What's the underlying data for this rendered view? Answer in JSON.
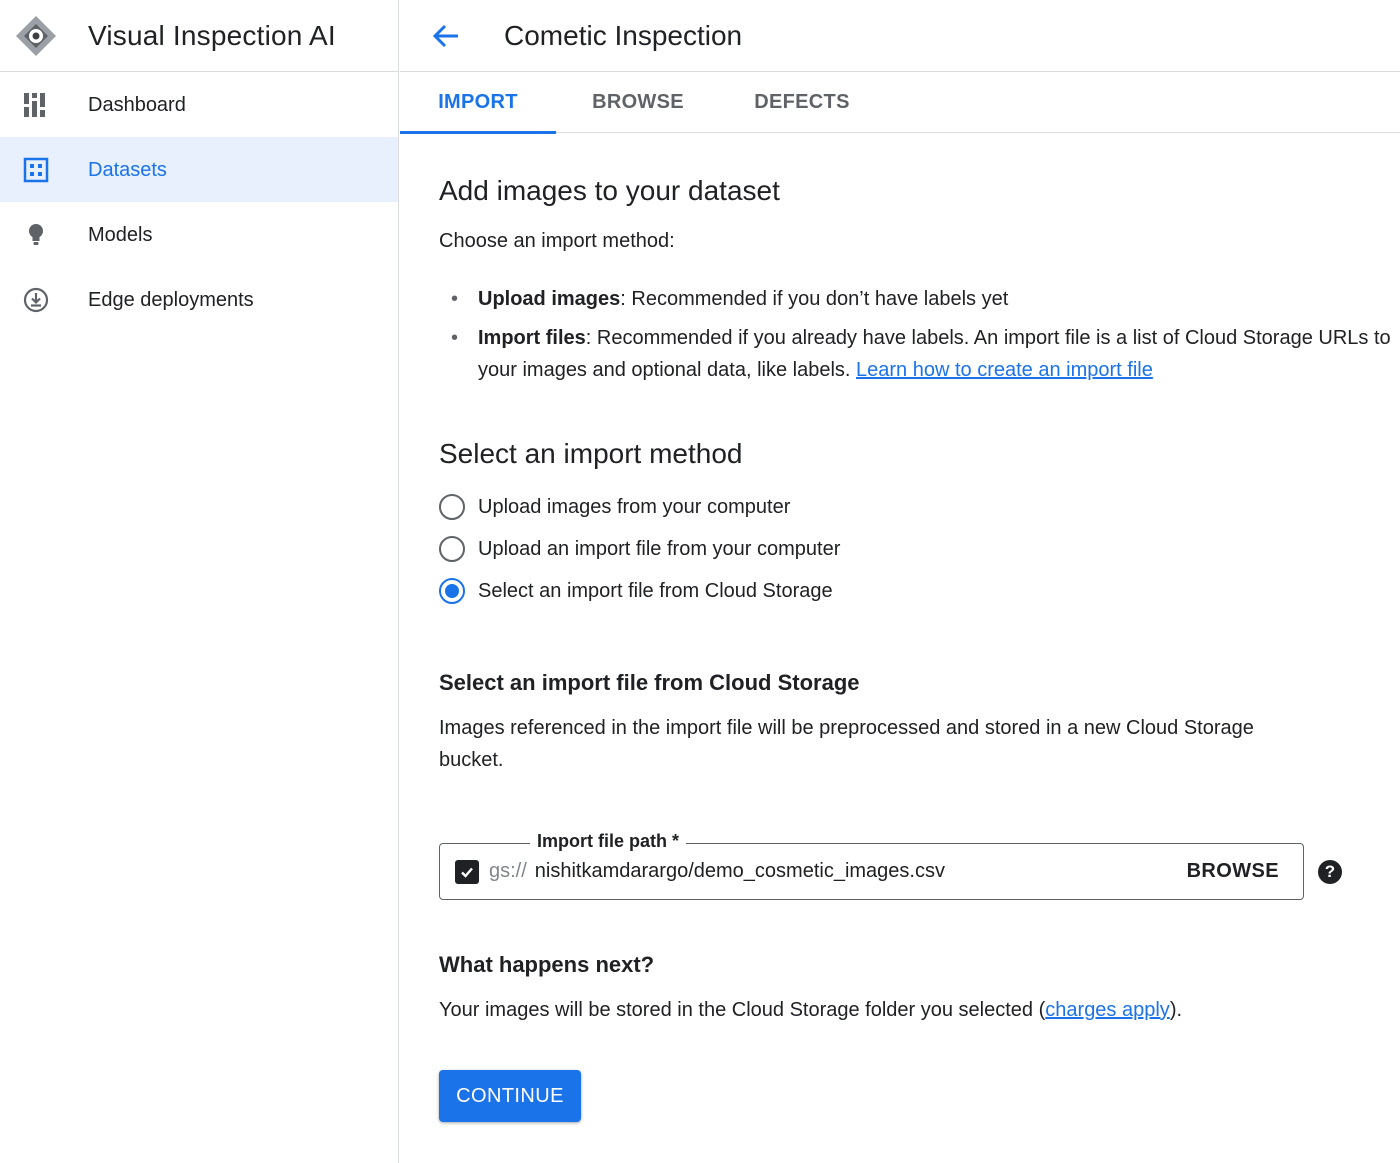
{
  "app": {
    "title": "Visual Inspection AI",
    "logo_icon": "visual-inspection-eye-logo",
    "accent_color": "#1a73e8"
  },
  "sidebar": {
    "items": [
      {
        "label": "Dashboard",
        "icon": "dashboard-icon",
        "active": false
      },
      {
        "label": "Datasets",
        "icon": "datasets-icon",
        "active": true
      },
      {
        "label": "Models",
        "icon": "lightbulb-icon",
        "active": false
      },
      {
        "label": "Edge deployments",
        "icon": "download-circle-icon",
        "active": false
      }
    ]
  },
  "header": {
    "title": "Cometic Inspection",
    "back_icon": "arrow-back-icon"
  },
  "tabs": [
    {
      "label": "IMPORT",
      "active": true
    },
    {
      "label": "BROWSE",
      "active": false
    },
    {
      "label": "DEFECTS",
      "active": false
    }
  ],
  "intro": {
    "heading": "Add images to your dataset",
    "lead": "Choose an import method:",
    "bullets": [
      {
        "strong": "Upload images",
        "text": ": Recommended if you don’t have labels yet"
      },
      {
        "strong": "Import files",
        "text": ": Recommended if you already have labels. An import file is a list of Cloud Storage URLs to your images and optional data, like labels. ",
        "link": "Learn how to create an import file"
      }
    ]
  },
  "method": {
    "heading": "Select an import method",
    "options": [
      {
        "label": "Upload images from your computer",
        "checked": false
      },
      {
        "label": "Upload an import file from your computer",
        "checked": false
      },
      {
        "label": "Select an import file from Cloud Storage",
        "checked": true
      }
    ]
  },
  "cloud": {
    "heading": "Select an import file from Cloud Storage",
    "description": "Images referenced in the import file will be preprocessed and stored in a new Cloud Storage bucket.",
    "field_label": "Import file path *",
    "prefix": "gs://",
    "value": "nishitkamdarargo/demo_cosmetic_images.csv",
    "browse_label": "BROWSE",
    "help_icon": "help-icon"
  },
  "next": {
    "heading": "What happens next?",
    "text_before": "Your images will be stored in the Cloud Storage folder you selected (",
    "link": "charges apply",
    "text_after": ")."
  },
  "continue_label": "CONTINUE"
}
